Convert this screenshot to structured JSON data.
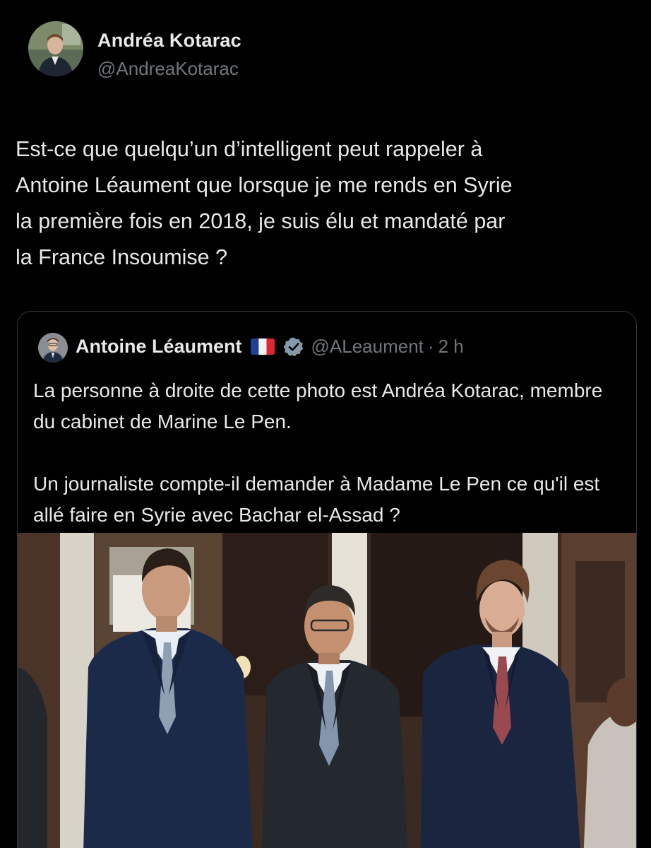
{
  "post": {
    "author": {
      "name": "Andréa Kotarac",
      "handle": "@AndreaKotarac"
    },
    "text": "Est-ce que quelqu’un d’intelligent peut rappeler à\nAntoine Léaument que lorsque je me rends en Syrie\nla première fois en 2018, je suis élu et mandaté par\nla France Insoumise ?"
  },
  "quoted": {
    "author": {
      "name": "Antoine Léaument",
      "handle": "@ALeaument",
      "separator": "·",
      "time": "2 h",
      "flag_icon": "france-flag-icon",
      "verified_icon": "verified-badge-icon"
    },
    "paragraphs": [
      "La personne à droite de cette photo est Andréa Kotarac, membre du cabinet de Marine Le Pen.",
      "Un journaliste compte-il demander à Madame Le Pen ce qu'il est allé faire en Syrie avec Bachar el-Assad ?"
    ]
  },
  "colors": {
    "background": "#000000",
    "text_primary": "#e7e9ea",
    "text_secondary": "#71767b",
    "border": "#2f3336",
    "verified": "#829aab"
  }
}
